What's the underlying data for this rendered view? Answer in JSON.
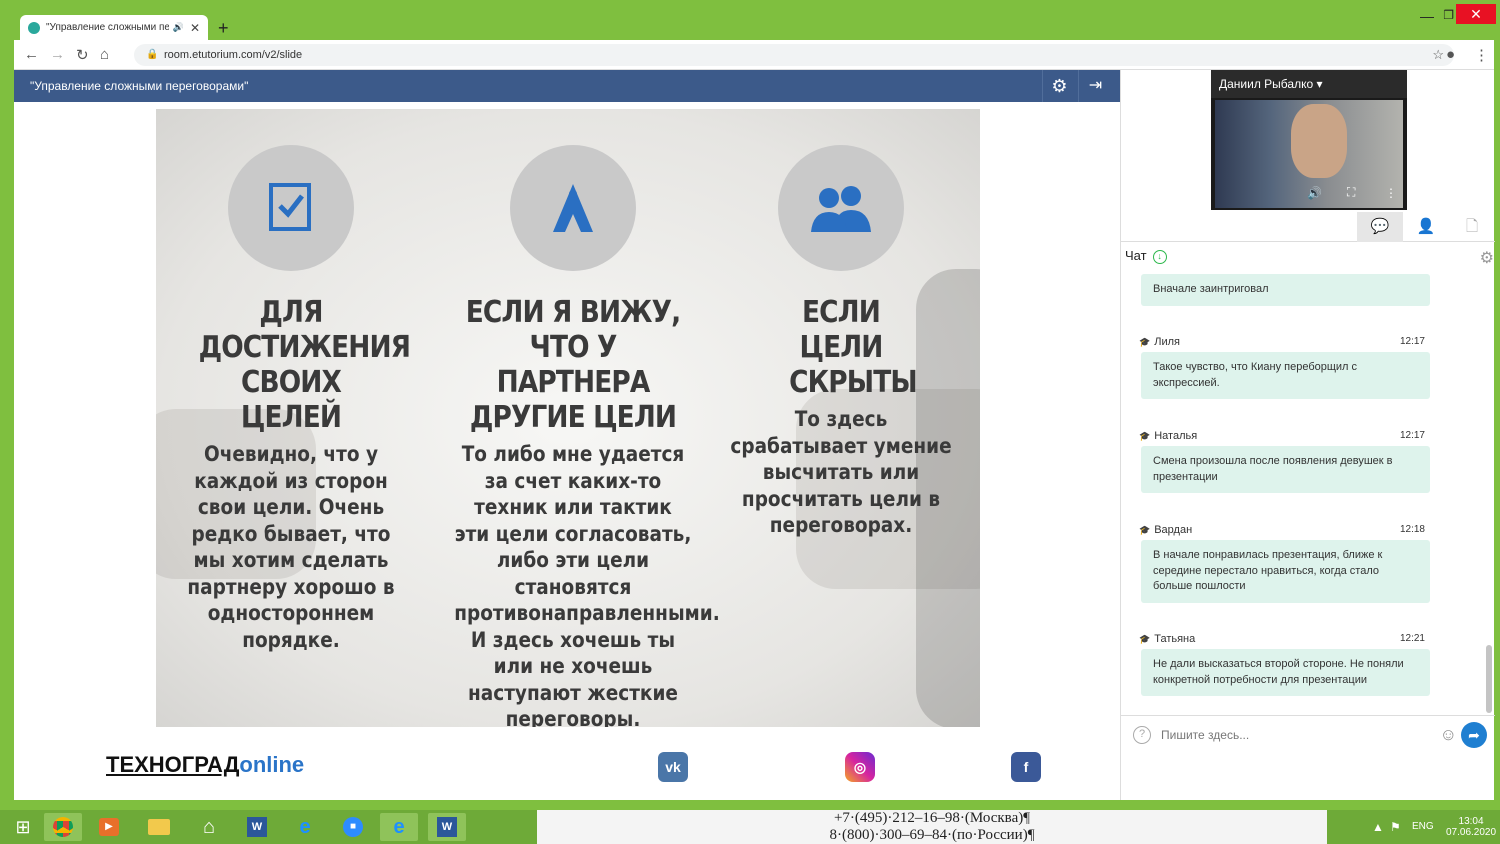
{
  "browser": {
    "tab_title": "\"Управление сложными пе",
    "new_tab": "+",
    "url": "room.etutorium.com/v2/slide",
    "window_min": "—",
    "window_max": "❐",
    "window_close": "✕"
  },
  "app": {
    "title": "\"Управление сложными переговорами\""
  },
  "slide": {
    "columns": [
      {
        "heading": "ДЛЯ ДОСТИЖЕНИЯ СВОИХ ЦЕЛЕЙ",
        "body": "Очевидно, что у каждой из сторон свои цели. Очень редко бывает, что мы хотим сделать партнеру хорошо в одностороннем порядке.",
        "icon": "checklist-icon"
      },
      {
        "heading": "ЕСЛИ Я ВИЖУ, ЧТО У ПАРТНЕРА ДРУГИЕ ЦЕЛИ",
        "body": "То либо мне удается за счет каких-то техник или тактик эти цели согласовать, либо эти цели становятся противонаправленными. И здесь хочешь ты или не хочешь наступают жесткие переговоры.",
        "icon": "mountain-climber-icon"
      },
      {
        "heading": "ЕСЛИ ЦЕЛИ СКРЫТЫ",
        "body": "То здесь срабатывает умение высчитать или просчитать цели в переговорах.",
        "icon": "users-icon"
      }
    ],
    "footer_brand_1": "ТЕХНОГРАД",
    "footer_brand_2": "online",
    "social": [
      "vk",
      "instagram",
      "facebook"
    ]
  },
  "presenter": {
    "name": "Даниил Рыбалко ▾"
  },
  "chat": {
    "title": "Чат",
    "messages": [
      {
        "author": "",
        "time": "",
        "text": "Вначале заинтриговал"
      },
      {
        "author": "Лиля",
        "time": "12:17",
        "text": "Такое чувство, что Киану переборщил с экспрессией."
      },
      {
        "author": "Наталья",
        "time": "12:17",
        "text": "Смена произошла после появления девушек в презентации"
      },
      {
        "author": "Вардан",
        "time": "12:18",
        "text": "В начале понравилась презентация, ближе к середине перестало нравиться, когда стало больше пошлости"
      },
      {
        "author": "Татьяна",
        "time": "12:21",
        "text": "Не дали высказаться второй стороне. Не поняли конкретной потребности для презентации"
      }
    ],
    "input_placeholder": "Пишите здесь..."
  },
  "taskbar": {
    "doc_line_1": "+7·(495)·212–16–98·(Москва)¶",
    "doc_line_2": "8·(800)·300–69–84·(по·России)¶",
    "lang": "ENG",
    "time": "13:04",
    "date": "07.06.2020"
  }
}
